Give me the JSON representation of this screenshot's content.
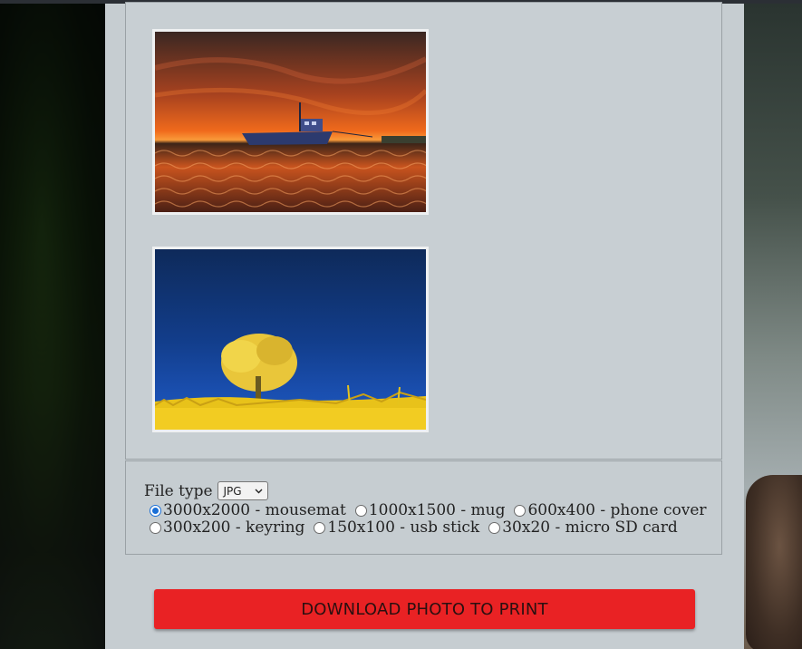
{
  "gallery": {
    "images": [
      {
        "alt": "fishing-boat-sunset-photo"
      },
      {
        "alt": "yellow-tree-blue-sky-photo"
      }
    ]
  },
  "options": {
    "file_type_label": "File type",
    "file_type_selected": "JPG",
    "sizes": [
      {
        "label": "3000x2000 - mousemat",
        "checked": true
      },
      {
        "label": "1000x1500 - mug",
        "checked": false
      },
      {
        "label": "600x400 - phone cover",
        "checked": false
      },
      {
        "label": "300x200 - keyring",
        "checked": false
      },
      {
        "label": "150x100 - usb stick",
        "checked": false
      },
      {
        "label": "30x20 - micro SD card",
        "checked": false
      }
    ]
  },
  "download": {
    "label": "DOWNLOAD PHOTO TO PRINT"
  },
  "colors": {
    "button": "#e92224",
    "panel": "#c6cdd1",
    "radio_accent": "#1a6fd6"
  }
}
